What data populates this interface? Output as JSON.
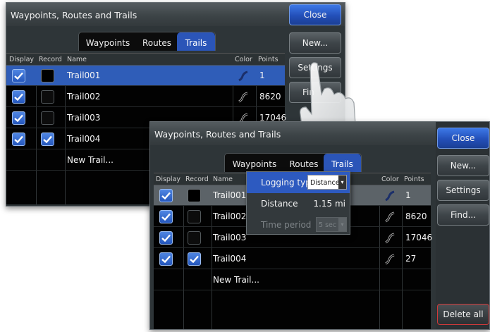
{
  "window_title": "Waypoints, Routes and Trails",
  "tabs": [
    {
      "label": "Waypoints",
      "active": false
    },
    {
      "label": "Routes",
      "active": false
    },
    {
      "label": "Trails",
      "active": true
    }
  ],
  "columns": {
    "display": "Display",
    "record": "Record",
    "name": "Name",
    "color": "Color",
    "points": "Points"
  },
  "buttons": {
    "close": "Close",
    "new": "New...",
    "settings": "Settings",
    "find": "Find...",
    "delete_all": "Delete all"
  },
  "back_find_partial": "Fin",
  "trails": [
    {
      "name": "Trail001",
      "display": true,
      "record": false,
      "record_filled": true,
      "points": "1",
      "color_style": "solid"
    },
    {
      "name": "Trail002",
      "display": true,
      "record": false,
      "record_filled": false,
      "points": "8620",
      "color_style": "outline"
    },
    {
      "name": "Trail003",
      "display": true,
      "record": false,
      "record_filled": false,
      "points": "17046",
      "color_style": "outline"
    },
    {
      "name": "Trail004",
      "display": true,
      "record": true,
      "record_filled": false,
      "points": "27",
      "color_style": "outline"
    }
  ],
  "new_trail_label": "New Trail...",
  "settings_popup": {
    "logging_type_label": "Logging type",
    "logging_type_value": "Distance",
    "distance_label": "Distance",
    "distance_value": "1.15 mi",
    "time_period_label": "Time period",
    "time_period_value": "5 sec"
  },
  "colors": {
    "accent": "#2b55b8",
    "window": "#2e3538",
    "grid": "#020202"
  }
}
